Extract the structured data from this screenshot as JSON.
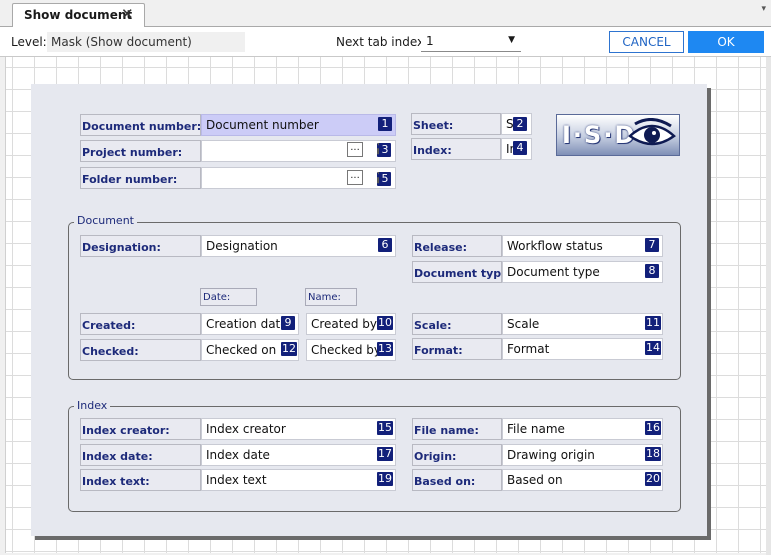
{
  "tab": {
    "title": "Show document",
    "close_glyph": "✕",
    "menu_glyph": "▾"
  },
  "toolbar": {
    "level_label": "Level:",
    "level_value": "Mask (Show document)",
    "next_tab_label": "Next tab index:",
    "next_tab_value": "1",
    "cancel_label": "CANCEL",
    "ok_label": "OK"
  },
  "header_fields": {
    "document_number": {
      "label": "Document number:",
      "value": "Document number",
      "badge": "1"
    },
    "project_number": {
      "label": "Project number:",
      "value": "",
      "badge": "3",
      "browse": "..."
    },
    "folder_number": {
      "label": "Folder number:",
      "value": "",
      "badge": "5",
      "browse": "..."
    },
    "sheet": {
      "label": "Sheet:",
      "value": "S",
      "badge": "2"
    },
    "index": {
      "label": "Index:",
      "value": "Ir",
      "badge": "4"
    }
  },
  "logo": {
    "text": "I·S·D",
    "icon": "eye-logo-icon"
  },
  "document_group": {
    "title": "Document",
    "designation": {
      "label": "Designation:",
      "value": "Designation",
      "badge": "6"
    },
    "release": {
      "label": "Release:",
      "value": "Workflow status",
      "badge": "7"
    },
    "document_type": {
      "label": "Document type:",
      "value": "Document type",
      "badge": "8"
    },
    "date_caption": "Date:",
    "name_caption": "Name:",
    "created": {
      "label": "Created:",
      "date_value": "Creation date",
      "date_badge": "9",
      "name_value": "Created by",
      "name_badge": "10"
    },
    "checked": {
      "label": "Checked:",
      "date_value": "Checked on",
      "date_badge": "12",
      "name_value": "Checked by",
      "name_badge": "13"
    },
    "scale": {
      "label": "Scale:",
      "value": "Scale",
      "badge": "11"
    },
    "format": {
      "label": "Format:",
      "value": "Format",
      "badge": "14"
    }
  },
  "index_group": {
    "title": "Index",
    "index_creator": {
      "label": "Index creator:",
      "value": "Index creator",
      "badge": "15"
    },
    "file_name": {
      "label": "File name:",
      "value": "File name",
      "badge": "16"
    },
    "index_date": {
      "label": "Index date:",
      "value": "Index date",
      "badge": "17"
    },
    "origin": {
      "label": "Origin:",
      "value": "Drawing origin",
      "badge": "18"
    },
    "index_text": {
      "label": "Index text:",
      "value": "Index text",
      "badge": "19"
    },
    "based_on": {
      "label": "Based on:",
      "value": "Based on",
      "badge": "20"
    }
  },
  "colors": {
    "badge": "#12207a",
    "label_text": "#1d2a7a",
    "ok_button": "#1e88f2",
    "highlight_field": "#ccccf7"
  }
}
